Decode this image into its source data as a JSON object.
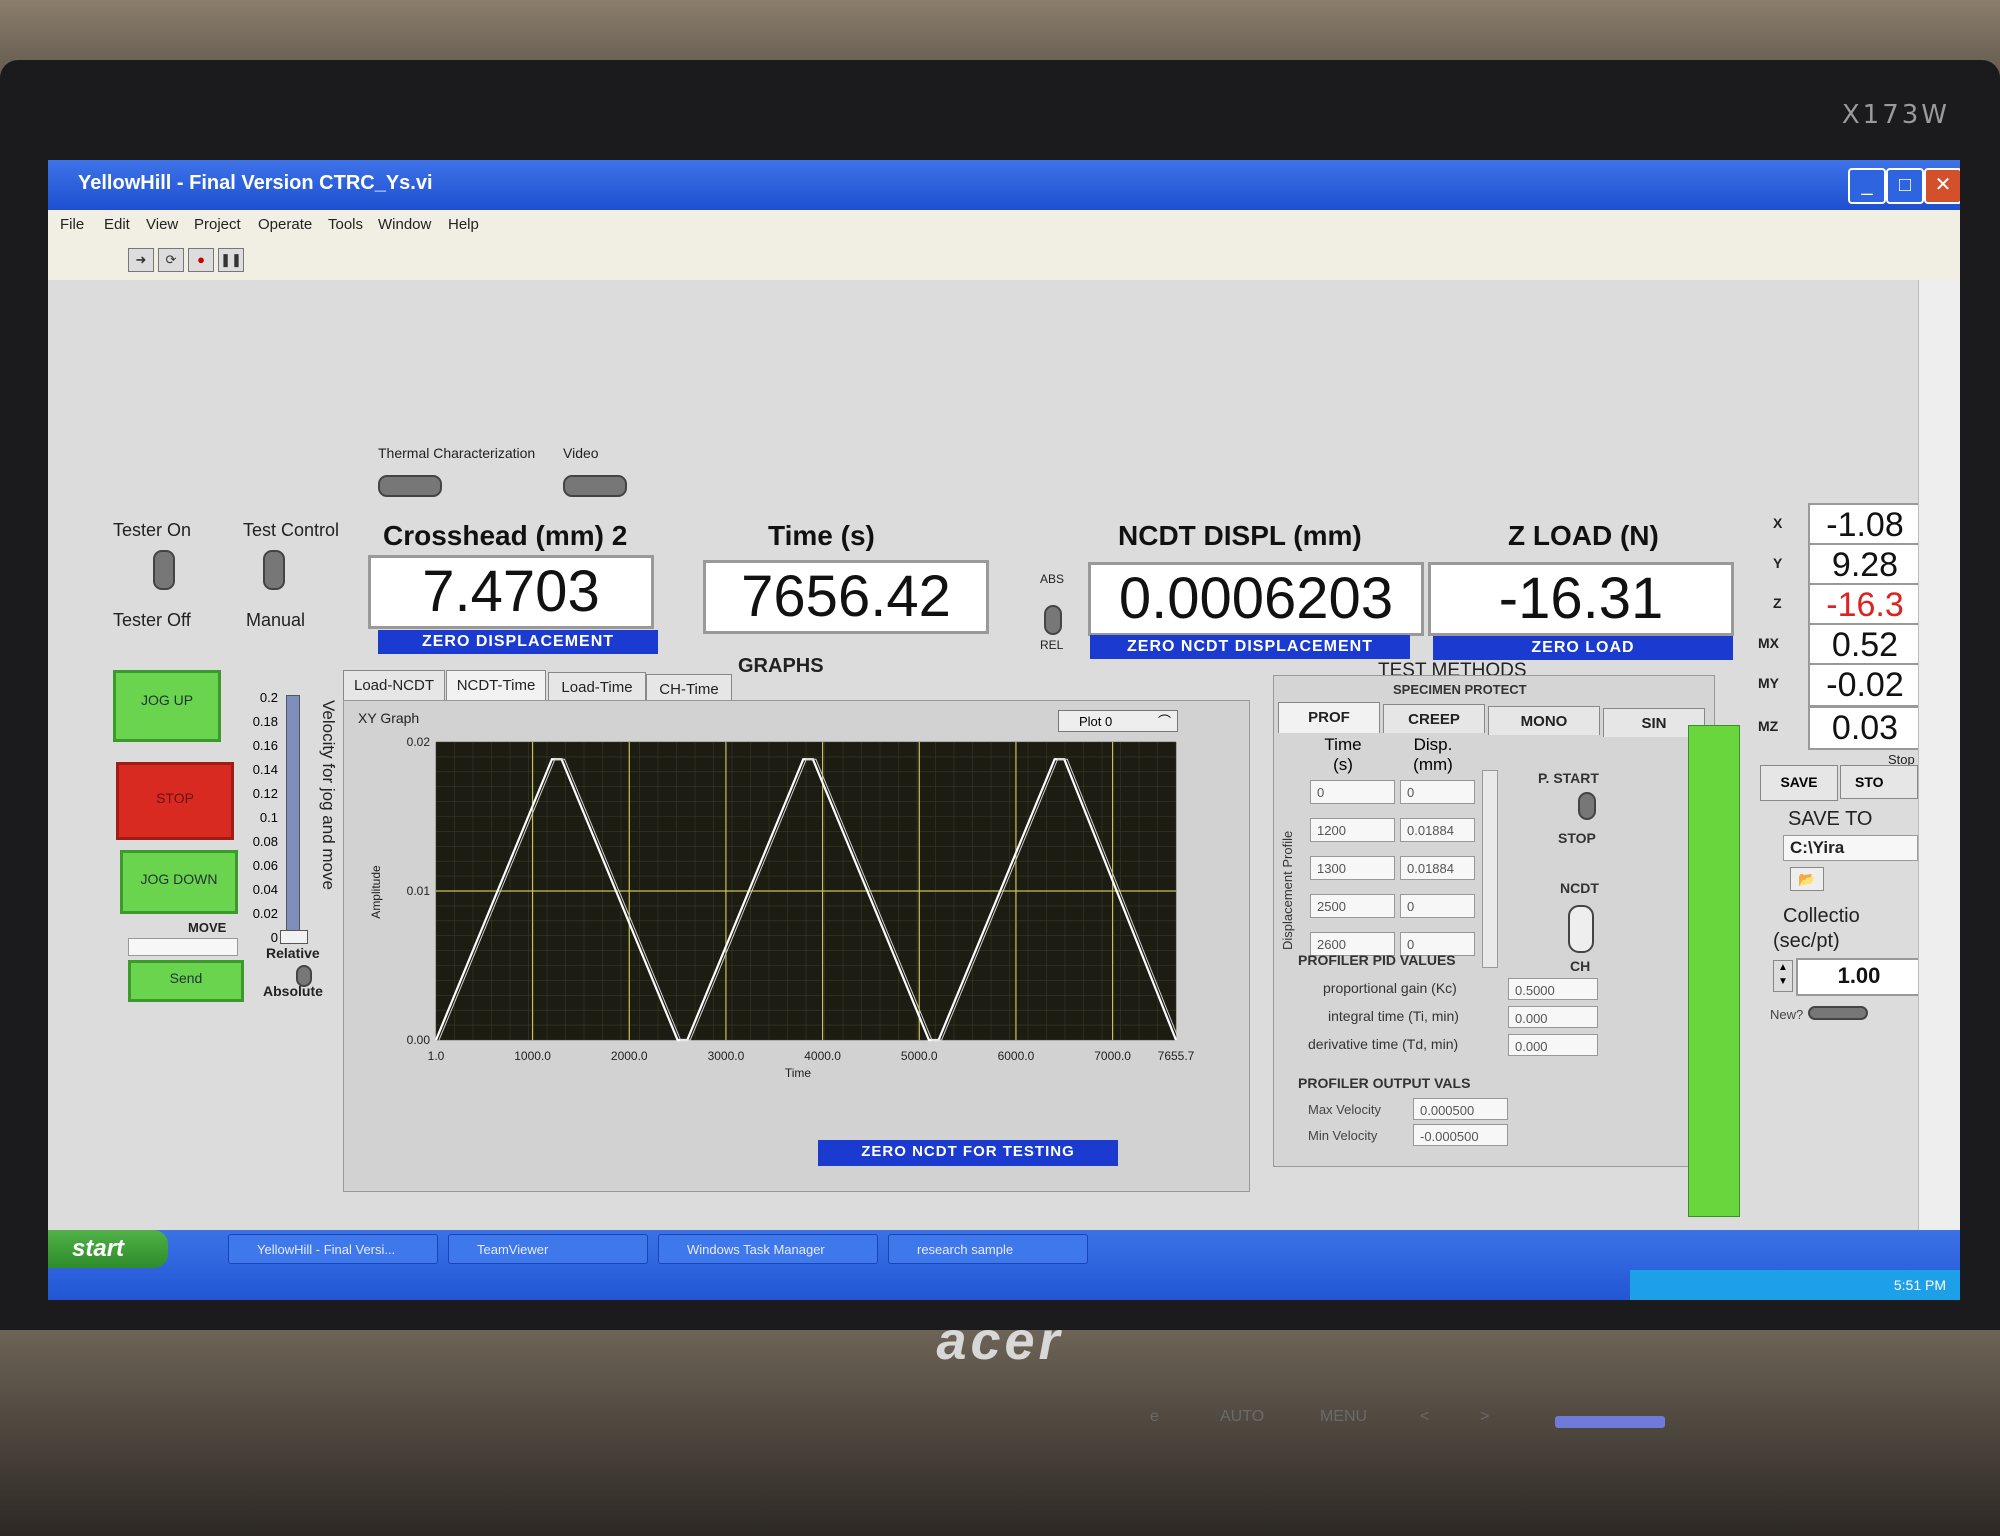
{
  "monitor": {
    "model": "X173W",
    "brand": "acer",
    "buttons": [
      "e",
      "AUTO",
      "MENU",
      "<",
      ">"
    ]
  },
  "window": {
    "title": "YellowHill - Final Version CTRC_Ys.vi",
    "buttons": [
      "minimize-icon",
      "maximize-icon",
      "close-icon"
    ]
  },
  "menu": [
    "File",
    "Edit",
    "View",
    "Project",
    "Operate",
    "Tools",
    "Window",
    "Help"
  ],
  "toolbar": {
    "run_icon": "run-arrow-icon",
    "continuous_icon": "run-continuous-icon",
    "abort_icon": "abort-icon",
    "pause_icon": "pause-icon"
  },
  "switches": {
    "thermal": "Thermal Characterization",
    "video": "Video",
    "tester_on": "Tester On",
    "tester_off": "Tester Off",
    "test_control": "Test Control",
    "manual": "Manual",
    "abs": "ABS",
    "rel": "REL"
  },
  "displays": {
    "crosshead": {
      "label": "Crosshead (mm) 2",
      "value": "7.4703",
      "button": "ZERO DISPLACEMENT"
    },
    "time": {
      "label": "Time (s)",
      "value": "7656.42"
    },
    "ncdt": {
      "label": "NCDT DISPL (mm)",
      "value": "0.0006203",
      "button": "ZERO NCDT DISPLACEMENT"
    },
    "zload": {
      "label": "Z LOAD (N)",
      "value": "-16.31",
      "button": "ZERO LOAD"
    }
  },
  "jog": {
    "up": "JOG UP",
    "stop": "STOP",
    "down": "JOG DOWN",
    "move": "MOVE",
    "send": "Send",
    "relative": "Relative",
    "absolute": "Absolute"
  },
  "velocity": {
    "label": "Velocity for jog and move",
    "ticks": [
      "0.2",
      "0.18",
      "0.16",
      "0.14",
      "0.12",
      "0.1",
      "0.08",
      "0.06",
      "0.04",
      "0.02",
      "0"
    ],
    "value": 0
  },
  "graphs": {
    "title": "GRAPHS",
    "tabs": [
      "Load-NCDT",
      "NCDT-Time",
      "Load-Time",
      "CH-Time"
    ],
    "active_tab": 1,
    "graph_label": "XY Graph",
    "plot_legend": "Plot 0",
    "zero_ncdt_button": "ZERO NCDT FOR TESTING"
  },
  "chart_data": {
    "type": "line",
    "xlabel": "Time",
    "ylabel": "Amplitude",
    "x_ticks": [
      "1.0",
      "1000.0",
      "2000.0",
      "3000.0",
      "4000.0",
      "5000.0",
      "6000.0",
      "7000.0",
      "7655.7"
    ],
    "y_ticks": [
      "0.02",
      "0.01",
      "0.00"
    ],
    "xlim": [
      1.0,
      7655.7
    ],
    "ylim": [
      0.0,
      0.02
    ],
    "grid": true,
    "series": [
      {
        "x": [
          1,
          1200,
          1300,
          2500,
          2600,
          3800,
          3900,
          5100,
          5200,
          6400,
          6500,
          7655.7
        ],
        "y": [
          0,
          0.01884,
          0.01884,
          0,
          0,
          0.01884,
          0.01884,
          0,
          0,
          0.01884,
          0.01884,
          0
        ],
        "color": "#ffffff"
      }
    ]
  },
  "test_methods": {
    "title": "TEST METHODS",
    "subtitle": "SPECIMEN PROTECT",
    "tabs": [
      "PROF",
      "CREEP",
      "MONO",
      "SIN"
    ],
    "profile_label": "Displacement Profile",
    "col_time": "Time\n(s)",
    "col_disp": "Disp.\n(mm)",
    "rows": [
      {
        "time": "0",
        "disp": "0"
      },
      {
        "time": "1200",
        "disp": "0.01884"
      },
      {
        "time": "1300",
        "disp": "0.01884"
      },
      {
        "time": "2500",
        "disp": "0"
      },
      {
        "time": "2600",
        "disp": "0"
      }
    ],
    "p_start": "P. START",
    "stop": "STOP",
    "ncdt": "NCDT",
    "ch": "CH",
    "pid_title": "PROFILER PID VALUES",
    "pid": [
      {
        "label": "proportional gain (Kc)",
        "value": "0.5000"
      },
      {
        "label": "integral time (Ti, min)",
        "value": "0.000"
      },
      {
        "label": "derivative time (Td, min)",
        "value": "0.000"
      }
    ],
    "output_title": "PROFILER OUTPUT VALS",
    "outputs": [
      {
        "label": "Max Velocity",
        "value": "0.000500"
      },
      {
        "label": "Min Velocity",
        "value": "-0.000500"
      }
    ]
  },
  "side": {
    "readouts": [
      {
        "label": "X",
        "value": "-1.08"
      },
      {
        "label": "Y",
        "value": "9.28"
      },
      {
        "label": "Z",
        "value": "-16.3"
      },
      {
        "label": "MX",
        "value": "0.52"
      },
      {
        "label": "MY",
        "value": "-0.02"
      },
      {
        "label": "MZ",
        "value": "0.03"
      }
    ],
    "stop_label": "Stop",
    "save": "SAVE",
    "stop_btn": "STO",
    "save_to": "SAVE TO",
    "path": "C:\\Yira",
    "collection": "Collectio",
    "collection_unit": "(sec/pt)",
    "collection_value": "1.00",
    "new_label": "New?"
  },
  "taskbar": {
    "start": "start",
    "items": [
      "YellowHill - Final Versi...",
      "TeamViewer",
      "Windows Task Manager",
      "research sample"
    ],
    "clock": "5:51 PM"
  }
}
